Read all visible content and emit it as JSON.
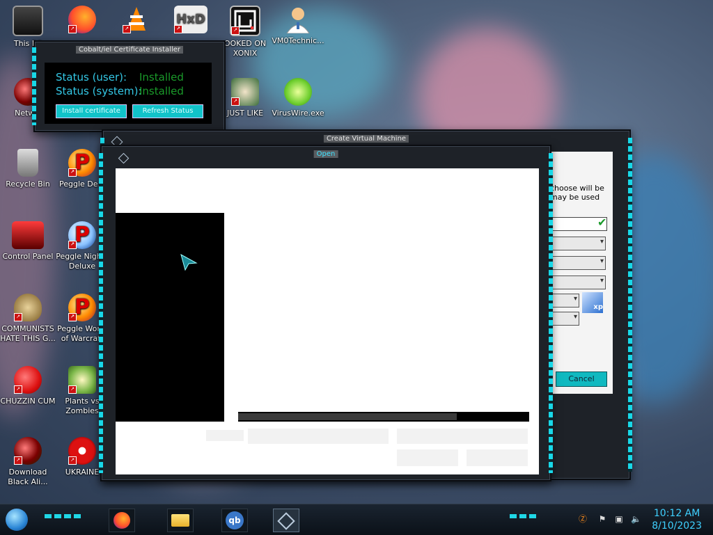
{
  "desktop": {
    "icons": [
      {
        "label": "This PC"
      },
      {
        "label": ""
      },
      {
        "label": ""
      },
      {
        "label": ""
      },
      {
        "label": "OOKED ON XONIX"
      },
      {
        "label": "VM0Technic..."
      },
      {
        "label": "Netw..."
      },
      {
        "label": "JUST LIKE"
      },
      {
        "label": "VirusWire.exe"
      },
      {
        "label": "Recycle Bin"
      },
      {
        "label": "Peggle De..."
      },
      {
        "label": "Control Panel"
      },
      {
        "label": "Peggle Nights Deluxe"
      },
      {
        "label": "COMMUNISTS HATE THIS G..."
      },
      {
        "label": "Peggle World of Warcraft"
      },
      {
        "label": "CHUZZIN CUM"
      },
      {
        "label": "Plants vs Zombies"
      },
      {
        "label": "Download Black Ali..."
      },
      {
        "label": "UKRAINE"
      }
    ]
  },
  "cert_window": {
    "title": "Cobalt/iel Certificate Installer",
    "status_user_label": "Status (user):",
    "status_user_value": "Installed",
    "status_system_label": "Status (system):",
    "status_system_value": "Installed",
    "install_button": "Install certificate",
    "refresh_button": "Refresh Status"
  },
  "back_window": {
    "title": "Create Virtual Machine",
    "hint_text": "choose will be may be used",
    "cancel_button": "Cancel",
    "os_badge": "xp"
  },
  "open_dialog": {
    "title": "Open",
    "progress": 0.75
  },
  "taskbar": {
    "apps": [
      "firefox-icon",
      "file-explorer-icon",
      "qbittorrent-icon",
      "virtualbox-icon"
    ],
    "qb_label": "qb",
    "time": "10:12 AM",
    "date": "8/10/2023"
  },
  "colors": {
    "accent": "#18d8e8",
    "installed_green": "#1a9a2a",
    "status_cyan": "#34c8e6",
    "clock": "#3fd0ff"
  }
}
